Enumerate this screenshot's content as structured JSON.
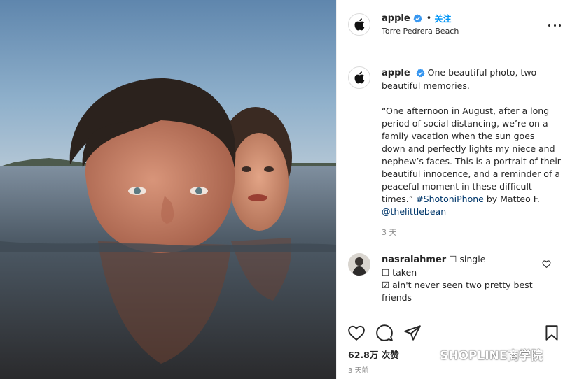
{
  "post": {
    "username": "apple",
    "follow_separator": "•",
    "follow_label": "关注",
    "location": "Torre Pedrera Beach",
    "more_icon": "more-horizontal-icon"
  },
  "caption": {
    "username": "apple",
    "intro": "One beautiful photo, two beautiful memories.",
    "quote": "“One afternoon in August, after a long period of social distancing, we’re on a family vacation when the sun goes down and perfectly lights my niece and nephew’s faces. This is a portrait of their beautiful innocence, and a reminder of a peaceful moment in these difficult times.”",
    "hashtag": "#ShotoniPhone",
    "byline_prefix": "by Matteo F.",
    "mention": "@thelittlebean",
    "time": "3 天"
  },
  "comment": {
    "username": "nasralahmer",
    "line1": "☐ single",
    "line2": "☐ taken",
    "line3": "☑ ain't never seen two pretty best friends"
  },
  "actions": {
    "like_icon": "heart-icon",
    "comment_icon": "comment-bubble-icon",
    "share_icon": "paper-plane-icon",
    "save_icon": "bookmark-icon",
    "likes_count": "62.8万",
    "likes_suffix": "次赞",
    "time": "3 天前"
  },
  "watermark": {
    "text": "SHOPLINE商学院"
  },
  "colors": {
    "link": "#00376b",
    "follow": "#0095f6",
    "verified": "#3897f0",
    "border": "#efefef",
    "muted": "#8e8e8e"
  }
}
